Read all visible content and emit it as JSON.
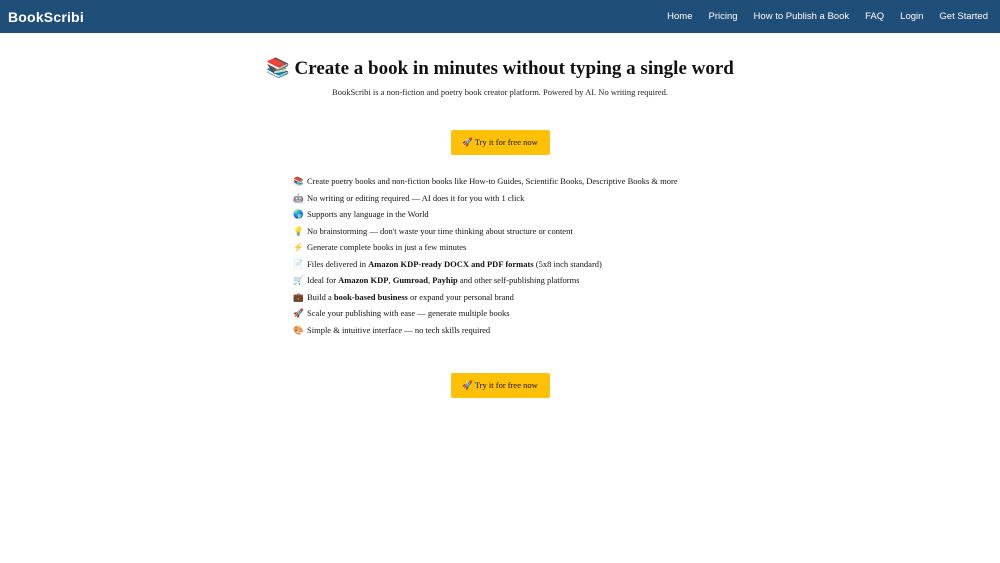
{
  "nav": {
    "brand": "BookScribi",
    "links": [
      "Home",
      "Pricing",
      "How to Publish a Book",
      "FAQ",
      "Login",
      "Get Started"
    ]
  },
  "hero": {
    "title_icon": "📚",
    "title": "Create a book in minutes without typing a single word",
    "subtitle": "BookScribi is a non-fiction and poetry book creator platform. Powered by AI. No writing required."
  },
  "cta": {
    "label": "🚀 Try it for free now"
  },
  "features": [
    {
      "icon": "📚",
      "icon_name": "books-icon",
      "pre": "Create poetry books and non-fiction books like How-to Guides, Scientific Books, Descriptive Books & more",
      "b1": "",
      "mid": "",
      "b2": "",
      "mid2": "",
      "b3": "",
      "post": ""
    },
    {
      "icon": "🤖",
      "icon_name": "robot-icon",
      "pre": "No writing or editing required — AI does it for you with 1 click",
      "b1": "",
      "mid": "",
      "b2": "",
      "mid2": "",
      "b3": "",
      "post": ""
    },
    {
      "icon": "🌎",
      "icon_name": "globe-icon",
      "pre": "Supports any language in the World",
      "b1": "",
      "mid": "",
      "b2": "",
      "mid2": "",
      "b3": "",
      "post": ""
    },
    {
      "icon": "💡",
      "icon_name": "lightbulb-icon",
      "pre": "No brainstorming — don't waste your time thinking about structure or content",
      "b1": "",
      "mid": "",
      "b2": "",
      "mid2": "",
      "b3": "",
      "post": ""
    },
    {
      "icon": "⚡",
      "icon_name": "lightning-icon",
      "pre": "Generate complete books in just a few minutes",
      "b1": "",
      "mid": "",
      "b2": "",
      "mid2": "",
      "b3": "",
      "post": ""
    },
    {
      "icon": "📄",
      "icon_name": "document-icon",
      "pre": "Files delivered in ",
      "b1": "Amazon KDP-ready DOCX and PDF formats",
      "mid": " (5x8 inch standard)",
      "b2": "",
      "mid2": "",
      "b3": "",
      "post": ""
    },
    {
      "icon": "🛒",
      "icon_name": "cart-icon",
      "pre": "Ideal for ",
      "b1": "Amazon KDP",
      "mid": ", ",
      "b2": "Gumroad",
      "mid2": ", ",
      "b3": "Payhip",
      "post": " and other self-publishing platforms"
    },
    {
      "icon": "💼",
      "icon_name": "briefcase-icon",
      "pre": "Build a ",
      "b1": "book-based business",
      "mid": " or expand your personal brand",
      "b2": "",
      "mid2": "",
      "b3": "",
      "post": ""
    },
    {
      "icon": "🚀",
      "icon_name": "rocket-icon",
      "pre": "Scale your publishing with ease — generate multiple books",
      "b1": "",
      "mid": "",
      "b2": "",
      "mid2": "",
      "b3": "",
      "post": ""
    },
    {
      "icon": "🎨",
      "icon_name": "palette-icon",
      "pre": "Simple & intuitive interface — no tech skills required",
      "b1": "",
      "mid": "",
      "b2": "",
      "mid2": "",
      "b3": "",
      "post": ""
    }
  ],
  "colors": {
    "navbar": "#1f4e79",
    "cta": "#ffc107"
  }
}
